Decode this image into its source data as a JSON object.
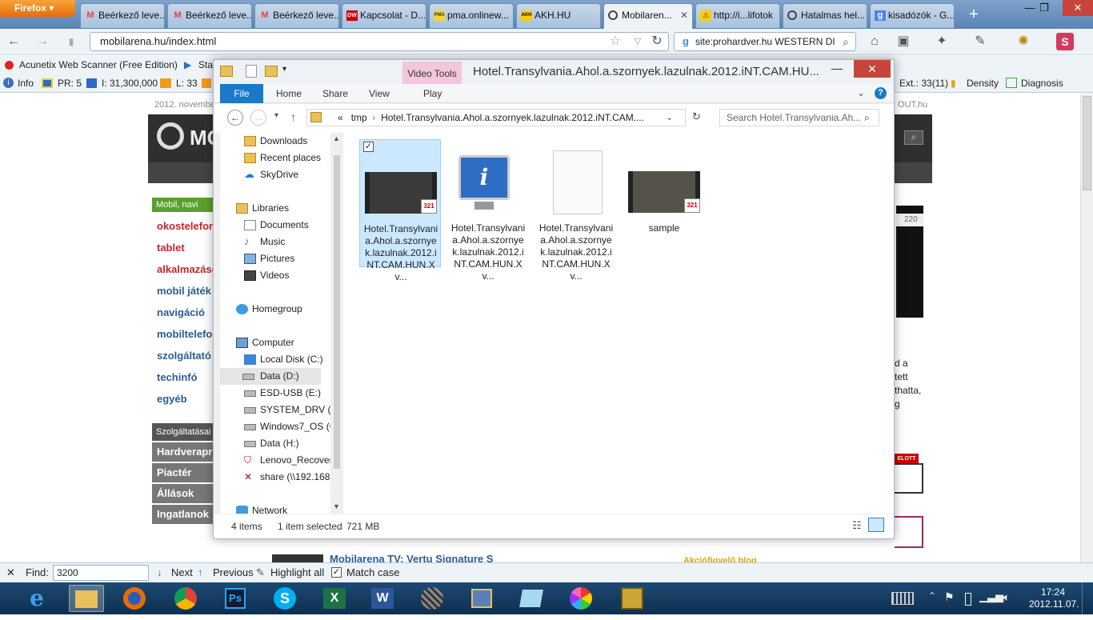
{
  "browser": {
    "menu_button": "Firefox",
    "tabs": [
      {
        "label": "Beérkező leve...",
        "icon": "gmail-icon"
      },
      {
        "label": "Beérkező leve...",
        "icon": "gmail-icon"
      },
      {
        "label": "Beérkező leve...",
        "icon": "gmail-icon"
      },
      {
        "label": "Kapcsolat - D...",
        "icon": "dw-icon",
        "icon_text": "DW"
      },
      {
        "label": "pma.onlinew...",
        "icon": "pma-icon",
        "icon_text": "PMA"
      },
      {
        "label": "AKH.HU",
        "icon": "akh-icon",
        "icon_text": "AKH"
      },
      {
        "label": "Mobilaren...",
        "icon": "mobilarena-icon",
        "active": true
      },
      {
        "label": "http://i...lifotok",
        "icon": "warning-icon"
      },
      {
        "label": "Hatalmas hel...",
        "icon": "mobilarena-icon"
      },
      {
        "label": "kisadózók - G...",
        "icon": "google-icon"
      }
    ],
    "url": "mobilarena.hu/index.html",
    "search_value": "site:prohardver.hu WESTERN DI",
    "bookmarks": [
      "Acunetix Web Scanner (Free Edition)",
      "Sta"
    ],
    "addon_bar": {
      "info": "Info",
      "pr": "PR: 5",
      "indexed": "I: 31,300,000",
      "links": "L: 33",
      "ext": "Ext.: 33(11)",
      "density": "Density",
      "diagnosis": "Diagnosis"
    },
    "find_bar": {
      "label": "Find:",
      "value": "3200",
      "next": "Next",
      "previous": "Previous",
      "highlight_all": "Highlight all",
      "match_case": "Match case"
    }
  },
  "website": {
    "date_fragment": "2012. novembe",
    "top_right": "OUT.hu",
    "logo_text": "MO",
    "nav_header": "Mobil, navi",
    "categories": [
      "okostelefon",
      "tablet",
      "alkalmazáso",
      "mobil játék",
      "navigáció",
      "mobiltelefo",
      "szolgáltató",
      "techinfó",
      "egyéb"
    ],
    "services_header": "Szolgáltatásai",
    "services": [
      "Hardverapró",
      "Piactér",
      "Állások",
      "Ingatlanok"
    ],
    "right_snippets": [
      "d a",
      "tett",
      "thatta,",
      "g"
    ],
    "counter": "220",
    "badge": "ELOTT",
    "bottom_link": "Mobilarena TV: Vertu Signature S",
    "bottom_right": "Akciófigyelő blog"
  },
  "explorer": {
    "title": "Hotel.Transylvania.Ahol.a.szornyek.lazulnak.2012.iNT.CAM.HU...",
    "contextual_tab": "Video Tools",
    "ribbon_tabs": [
      "File",
      "Home",
      "Share",
      "View",
      "Play"
    ],
    "breadcrumb": [
      "«",
      "tmp",
      "Hotel.Transylvania.Ahol.a.szornyek.lazulnak.2012.iNT.CAM...."
    ],
    "search_placeholder": "Search Hotel.Transylvania.Ah...",
    "nav": {
      "favorites": [
        "Downloads",
        "Recent places",
        "SkyDrive"
      ],
      "libraries": "Libraries",
      "library_items": [
        "Documents",
        "Music",
        "Pictures",
        "Videos"
      ],
      "homegroup": "Homegroup",
      "computer": "Computer",
      "drives": [
        "Local Disk (C:)",
        "Data (D:)",
        "ESD-USB (E:)",
        "SYSTEM_DRV (F:)",
        "Windows7_OS (G",
        "Data (H:)",
        "Lenovo_Recovery",
        "share (\\\\192.168."
      ],
      "network": "Network"
    },
    "files": [
      {
        "name": "Hotel.Transylvania.Ahol.a.szornyek.lazulnak.2012.iNT.CAM.HUN.Xv...",
        "type": "video",
        "selected": true
      },
      {
        "name": "Hotel.Transylvania.Ahol.a.szornyek.lazulnak.2012.iNT.CAM.HUN.Xv...",
        "type": "info"
      },
      {
        "name": "Hotel.Transylvania.Ahol.a.szornyek.lazulnak.2012.iNT.CAM.HUN.Xv...",
        "type": "blank"
      },
      {
        "name": "sample",
        "type": "video"
      }
    ],
    "status": {
      "count": "4 items",
      "selection": "1 item selected",
      "size": "721 MB"
    }
  },
  "taskbar": {
    "apps": [
      "ie-icon",
      "explorer-icon",
      "firefox-icon",
      "chrome-icon",
      "photoshop-icon",
      "skype-icon",
      "excel-icon",
      "word-icon",
      "globe-icon",
      "network-tool-icon",
      "paper-icon",
      "picasa-icon",
      "keepass-icon"
    ],
    "ps_text": "Ps",
    "xl_text": "X",
    "wd_text": "W",
    "time": "17:24",
    "date": "2012.11.07."
  },
  "colors": {
    "firefox_orange": "#e66b0c",
    "explorer_blue": "#1979ca",
    "video_tools_pink": "#f3c6dc",
    "site_green": "#5aa02c",
    "site_link_red": "#c0272d",
    "site_link_blue": "#2a5c93"
  }
}
